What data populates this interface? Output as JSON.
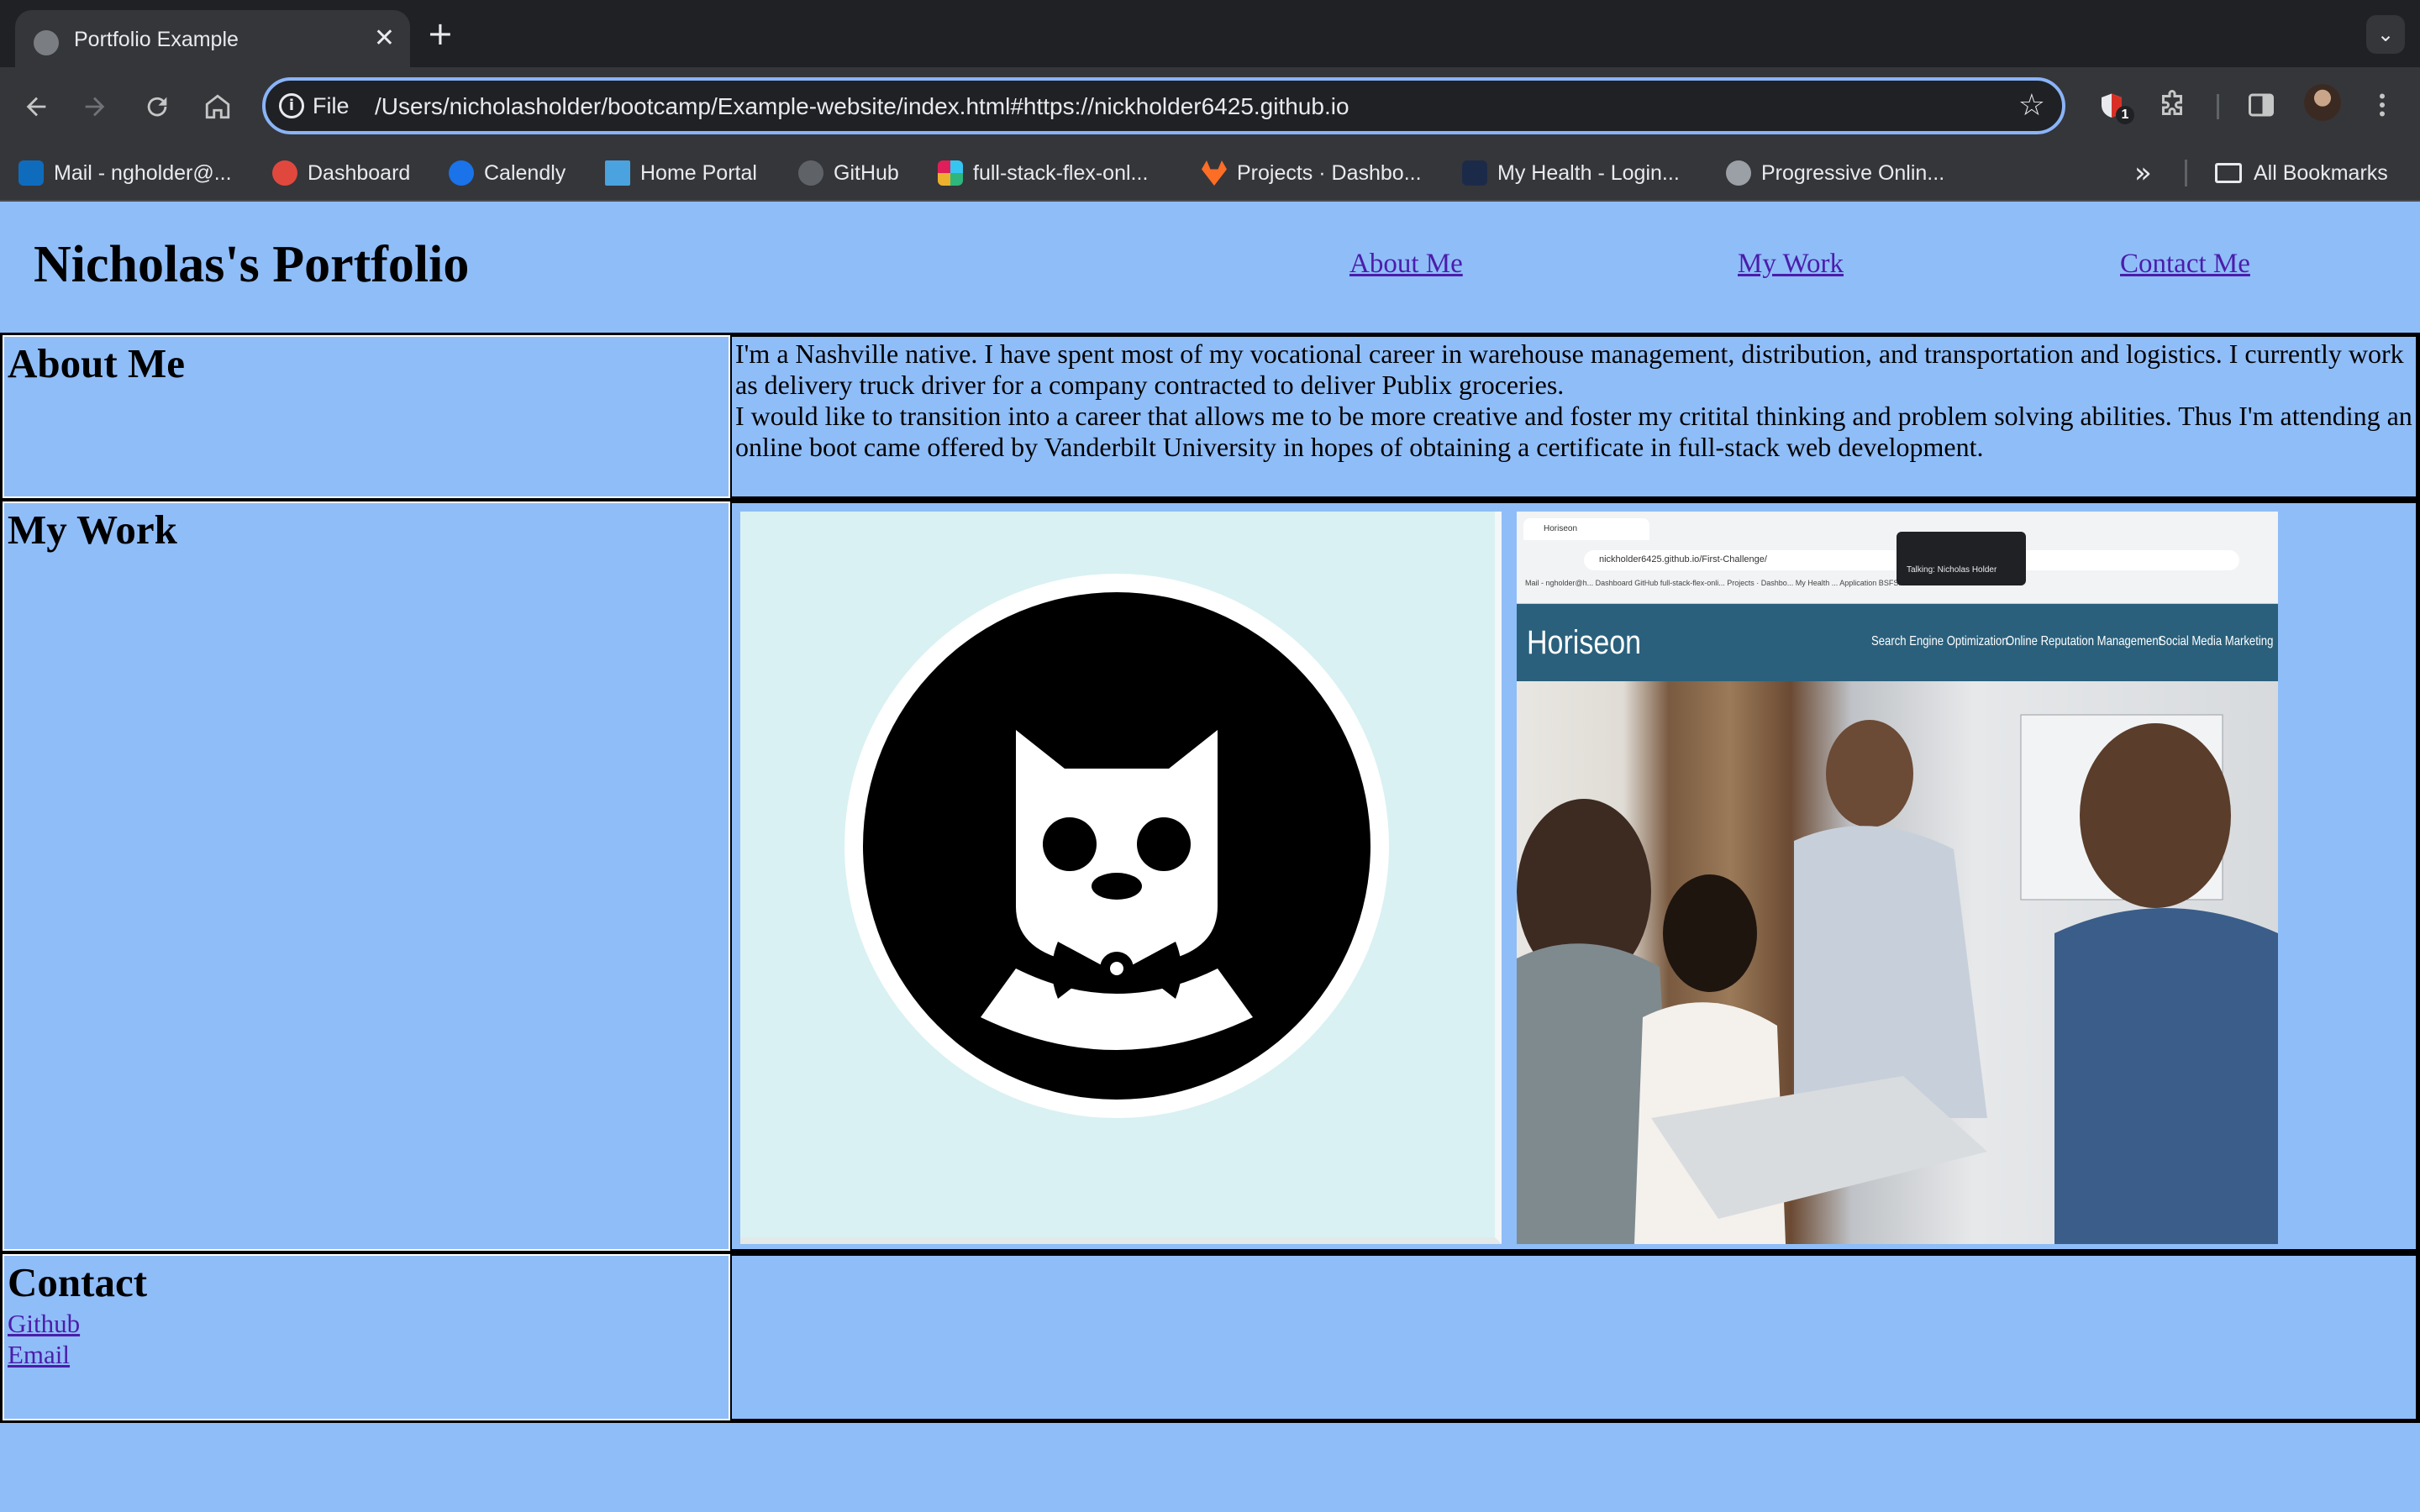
{
  "browser": {
    "tab_title": "Portfolio Example",
    "tab_close": "✕",
    "new_tab": "+",
    "tab_search": "⌄",
    "scheme": "File",
    "url": "/Users/nicholasholder/bootcamp/Example-website/index.html#https://nickholder6425.github.io",
    "extension_badge": "1",
    "bookmarks": [
      {
        "label": "Mail - ngholder@...",
        "icon": "outlook-icon",
        "color": "#0f6cbd"
      },
      {
        "label": "Dashboard",
        "icon": "dashboard-icon",
        "color": "#e0483e"
      },
      {
        "label": "Calendly",
        "icon": "calendly-icon",
        "color": "#1a73e8"
      },
      {
        "label": "Home Portal",
        "icon": "home-portal-icon",
        "color": "#4aa3df"
      },
      {
        "label": "GitHub",
        "icon": "github-icon",
        "color": "#5f6368"
      },
      {
        "label": "full-stack-flex-onl...",
        "icon": "slack-icon",
        "color": "#e01e5a"
      },
      {
        "label": "Projects · Dashbo...",
        "icon": "gitlab-icon",
        "color": "#fc6d26"
      },
      {
        "label": "My Health - Login...",
        "icon": "health-icon",
        "color": "#1c2a4a"
      },
      {
        "label": "Progressive Onlin...",
        "icon": "globe-icon",
        "color": "#9aa0a6"
      }
    ],
    "bookmarks_more": "»",
    "all_bookmarks": "All Bookmarks"
  },
  "site": {
    "title": "Nicholas's Portfolio",
    "nav": [
      "About Me",
      "My Work",
      "Contact Me"
    ]
  },
  "sections": {
    "about": {
      "heading": "About Me",
      "paragraph_1": "I'm a Nashville native. I have spent most of my vocational career in warehouse management, distribution, and transportation and logistics. I currently work as delivery truck driver for a company contracted to deliver Publix groceries.",
      "paragraph_2": "I would like to transition into a career that allows me to be more creative and foster my critital thinking and problem solving abilities. Thus I'm attending an online boot came offered by Vanderbilt University in hopes of obtaining a certificate in full-stack web development."
    },
    "work": {
      "heading": "My Work",
      "screenshot": {
        "tab": "Horiseon",
        "url": "nickholder6425.github.io/First-Challenge/",
        "bookmarks": "Mail - ngholder@h...   Dashboard   GitHub   full-stack-flex-onli...   Projects · Dashbo...   My Health   ...   Application BSFS...   Welcome to Neline...   Intranet",
        "popup": "Talking: Nicholas Holder",
        "brand": "Horiseon",
        "nav": [
          "Search Engine Optimization",
          "Online Reputation Management",
          "Social Media Marketing"
        ]
      }
    },
    "contact": {
      "heading": "Contact",
      "links": [
        "Github",
        "Email"
      ]
    }
  },
  "colors": {
    "page_background": "#8fbdf8",
    "link": "#4b1dab",
    "chrome_dark": "#202124",
    "chrome_toolbar": "#35363a",
    "omnibox_focus": "#8ab4f8",
    "horiseon_header": "#2a607c"
  }
}
